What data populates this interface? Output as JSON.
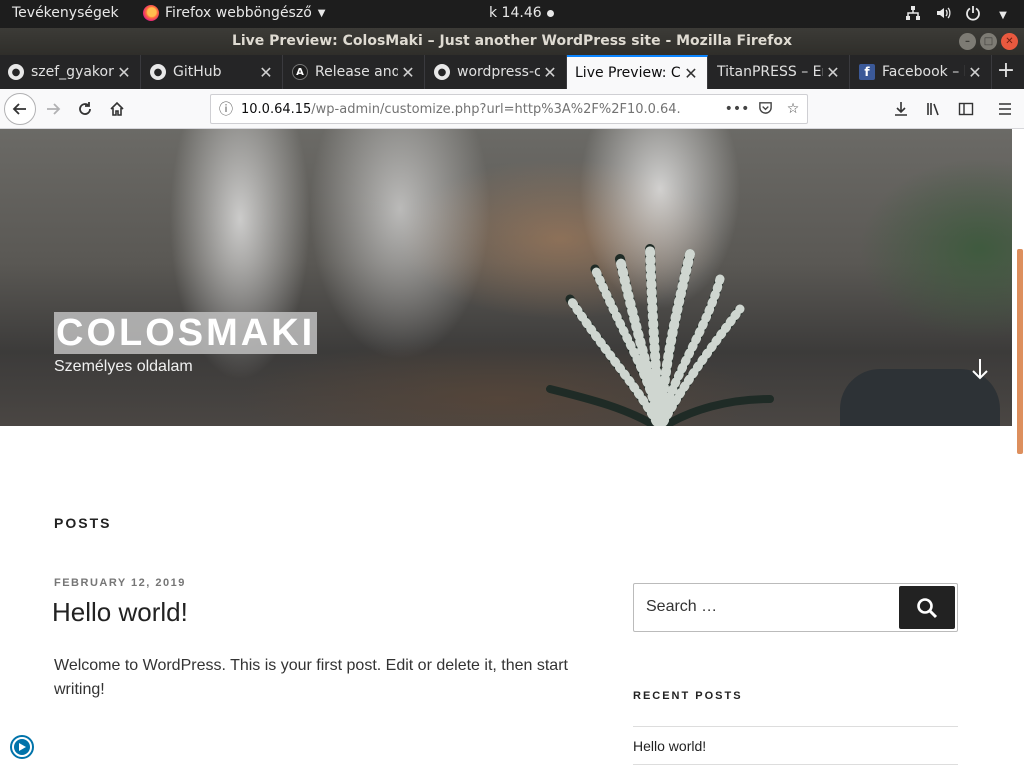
{
  "gnome": {
    "activities": "Tevékenységek",
    "app_menu": "Firefox webböngésző",
    "clock": "k 14.46"
  },
  "window": {
    "title": "Live Preview: ColosMaki – Just another WordPress site - Mozilla Firefox"
  },
  "tabs": [
    {
      "label": "szef_gyakor",
      "icon": "github-icon"
    },
    {
      "label": "GitHub",
      "icon": "github-icon"
    },
    {
      "label": "Release and",
      "icon": "angular-icon"
    },
    {
      "label": "wordpress-c",
      "icon": "github-icon"
    },
    {
      "label": "Live Preview: Co",
      "icon": "none",
      "active": true
    },
    {
      "label": "TitanPRESS – Er",
      "icon": "none"
    },
    {
      "label": "Facebook – l",
      "icon": "facebook-icon"
    }
  ],
  "urlbar": {
    "host": "10.0.64.15",
    "path": "/wp-admin/customize.php?url=http%3A%2F%2F10.0.64."
  },
  "site": {
    "title": "COLOSMAKI",
    "tagline": "Személyes oldalam"
  },
  "main": {
    "section_heading": "POSTS",
    "post": {
      "date": "FEBRUARY 12, 2019",
      "title": "Hello world!",
      "body": "Welcome to WordPress. This is your first post. Edit or delete it, then start writing!"
    }
  },
  "sidebar": {
    "search_placeholder": "Search …",
    "recent_heading": "RECENT POSTS",
    "recent_items": [
      "Hello world!"
    ]
  },
  "colors": {
    "accent": "#0a84ff",
    "wp_blue": "#0073aa"
  }
}
